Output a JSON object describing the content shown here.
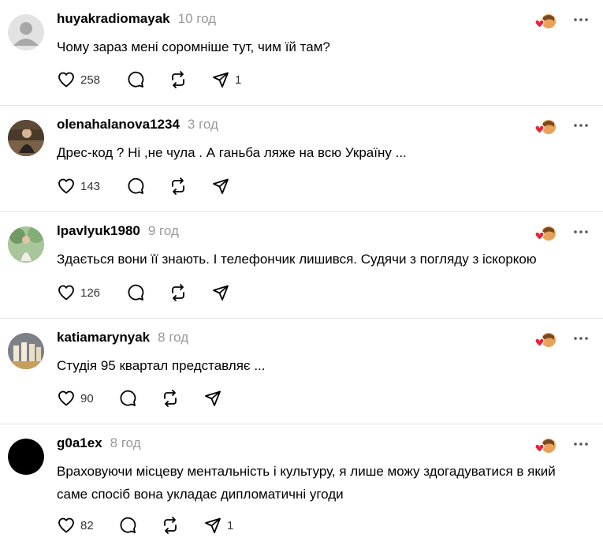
{
  "colors": {
    "text": "#000000",
    "muted": "#999999",
    "divider": "#e3e3e3",
    "icon": "#000000",
    "reaction_heart": "#e8243a"
  },
  "icons": {
    "like": "heart-icon",
    "comment": "comment-bubble-icon",
    "repost": "repost-icon",
    "share": "send-icon",
    "more": "more-horizontal-icon",
    "reaction": "author-liked-avatar-icon"
  },
  "posts": [
    {
      "username": "huyakradiomayak",
      "time": "10 год",
      "text": "Чому зараз мені соромніше тут, чим їй там?",
      "likes": "258",
      "comments": "",
      "reposts": "",
      "shares": "1",
      "avatar": "default-avatar-icon"
    },
    {
      "username": "olenahalanova1234",
      "time": "3 год",
      "text": "Дрес-код ? Ні ,не чула . А ганьба ляже на всю Україну ...",
      "likes": "143",
      "comments": "",
      "reposts": "",
      "shares": "",
      "avatar": "user-photo-avatar"
    },
    {
      "username": "lpavlyuk1980",
      "time": "9 год",
      "text": "Здається вони її знають. І телефончик лишився. Судячи з погляду з іскоркою",
      "likes": "126",
      "comments": "",
      "reposts": "",
      "shares": "",
      "avatar": "user-photo-avatar"
    },
    {
      "username": "katiamarynyak",
      "time": "8 год",
      "text": "Студія 95 квартал представляє ...",
      "likes": "90",
      "comments": "",
      "reposts": "",
      "shares": "",
      "avatar": "user-photo-avatar"
    },
    {
      "username": "g0a1ex",
      "time": "8 год",
      "text": "Враховуючи місцеву ментальність і культуру, я лише можу здогадуватися в який саме спосіб вона укладає дипломатичні угоди",
      "likes": "82",
      "comments": "",
      "reposts": "",
      "shares": "1",
      "avatar": "black-avatar"
    }
  ]
}
